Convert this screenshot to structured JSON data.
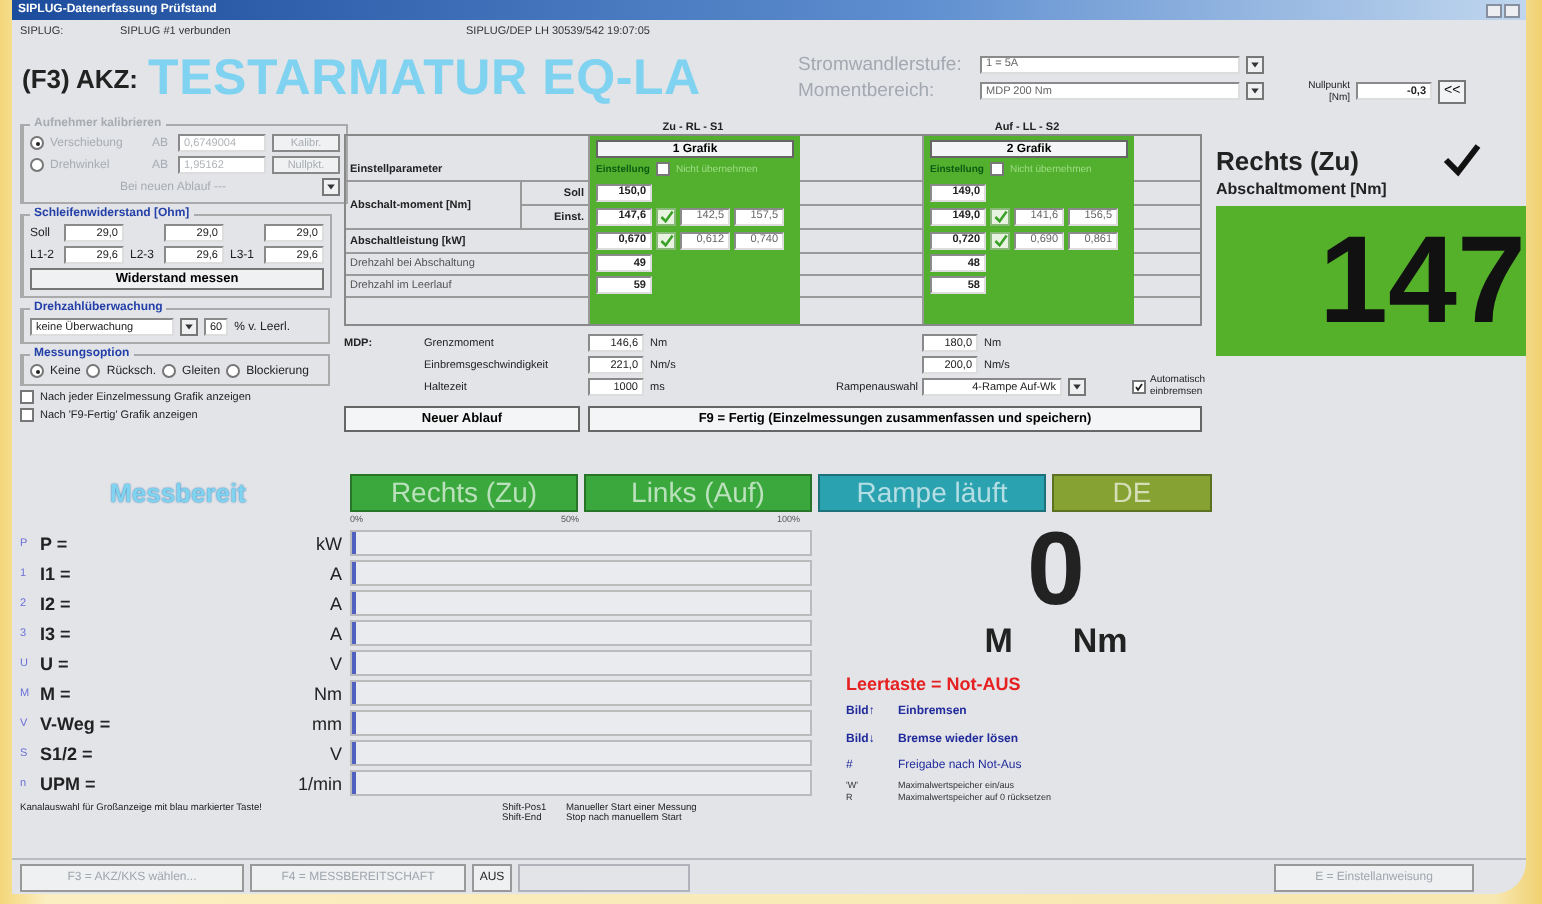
{
  "window": {
    "title": "SIPLUG-Datenerfassung Prüfstand"
  },
  "info_bar": {
    "device_label": "SIPLUG:",
    "connection": "SIPLUG #1 verbunden",
    "station": "SIPLUG/DEP LH 30539/542 19:07:05"
  },
  "header": {
    "akz_label": "(F3) AKZ:",
    "akz": "TESTARMATUR EQ-LA",
    "current_stage": {
      "label": "Stromwandlerstufe:",
      "value": "1 = 5A"
    },
    "torque_range": {
      "label": "Momentbereich:",
      "value": "MDP  200 Nm"
    },
    "zero_point": {
      "label": "Nullpunkt [Nm]",
      "value": "-0,3",
      "button": "<<"
    }
  },
  "calibration": {
    "title": "Aufnehmer kalibrieren",
    "disabled": true,
    "options": [
      {
        "label": "Verschiebung",
        "selected": true,
        "field_label": "AB",
        "value": "0,6749004",
        "button": "Kalibr."
      },
      {
        "label": "Drehwinkel",
        "selected": false,
        "field_label": "AB",
        "value": "1,95162",
        "button": "Nullpkt."
      }
    ],
    "note": "Bei neuen Ablauf ---"
  },
  "resistance": {
    "title": "Schleifenwiderstand [Ohm]",
    "set_label": "Soll",
    "set_values": [
      "29,0",
      "29,0",
      "29,0"
    ],
    "measured": [
      {
        "label": "L1-2",
        "value": "29,6"
      },
      {
        "label": "L2-3",
        "value": "29,6"
      },
      {
        "label": "L3-1",
        "value": "29,6"
      }
    ],
    "button": "Widerstand messen"
  },
  "speed_monitoring": {
    "title": "Drehzahlüberwachung",
    "mode": "keine Überwachung",
    "value": "60",
    "unit": "% v. Leerl."
  },
  "measurement_option": {
    "title": "Messungsoption",
    "options": [
      {
        "label": "Keine",
        "selected": true
      },
      {
        "label": "Rücksch.",
        "selected": false
      },
      {
        "label": "Gleiten",
        "selected": false
      },
      {
        "label": "Blockierung",
        "selected": false
      }
    ]
  },
  "graph_options": [
    {
      "label": "Nach jeder Einzelmessung Grafik anzeigen",
      "checked": false
    },
    {
      "label": "Nach 'F9-Fertig' Grafik anzeigen",
      "checked": false
    }
  ],
  "parameters": {
    "rows_label": "Einstellparameter",
    "torque_label": "Abschalt-moment [Nm]",
    "set_label": "Soll",
    "actual_label": "Einst.",
    "power_label": "Abschaltleistung [kW]",
    "speed_cutoff_label": "Drehzahl bei Abschaltung",
    "speed_idle_label": "Drehzahl im Leerlauf",
    "columns": [
      {
        "heading": "Zu - RL - S1",
        "button": "1 Grafik",
        "setting_label": "Einstellung",
        "skip_label": "Nicht übernehmen",
        "skip": false,
        "torque_set": "150,0",
        "torque_actual": "147,6",
        "torque_ok": true,
        "torque_min": "142,5",
        "torque_max": "157,5",
        "power": "0,670",
        "power_ok": true,
        "power_min": "0,612",
        "power_max": "0,740",
        "speed_cutoff": "49",
        "speed_idle": "59"
      },
      {
        "heading": "Auf - LL - S2",
        "button": "2 Grafik",
        "setting_label": "Einstellung",
        "skip_label": "Nicht übernehmen",
        "skip": false,
        "torque_set": "149,0",
        "torque_actual": "149,0",
        "torque_ok": true,
        "torque_min": "141,6",
        "torque_max": "156,5",
        "power": "0,720",
        "power_ok": true,
        "power_min": "0,690",
        "power_max": "0,861",
        "speed_cutoff": "48",
        "speed_idle": "58"
      }
    ]
  },
  "mdp": {
    "label": "MDP:",
    "rows": [
      {
        "label": "Grenzmoment",
        "value_1": "146,6",
        "unit_1": "Nm",
        "value_2": "180,0",
        "unit_2": "Nm"
      },
      {
        "label": "Einbremsgeschwindigkeit",
        "value_1": "221,0",
        "unit_1": "Nm/s",
        "value_2": "200,0",
        "unit_2": "Nm/s"
      },
      {
        "label": "Haltezeit",
        "value_1": "1000",
        "unit_1": "ms"
      }
    ],
    "ramp": {
      "label": "Rampenauswahl",
      "value": "4-Rampe Auf-Wk"
    },
    "auto_brake": {
      "label": "Automatisch einbremsen",
      "checked": true
    }
  },
  "actions": [
    "Neuer Ablauf",
    "F9 = Fertig (Einzelmessungen zusammenfassen und speichern)"
  ],
  "result": {
    "direction": "Rechts (Zu)",
    "ok": true,
    "label": "Abschaltmoment [Nm]",
    "value": "147"
  },
  "status": {
    "title": "Messbereit",
    "tiles": [
      {
        "label": "Rechts (Zu)",
        "color": "#3aa83c"
      },
      {
        "label": "Links (Auf)",
        "color": "#3aa83c"
      },
      {
        "label": "Rampe läuft",
        "color": "#2aa2b0"
      },
      {
        "label": "DE",
        "color": "#86a232"
      }
    ]
  },
  "channels": {
    "scale": [
      "0%",
      "50%",
      "100%"
    ],
    "rows": [
      {
        "key": "P",
        "label": "P =",
        "unit": "kW",
        "level": 0
      },
      {
        "key": "1",
        "label": "I1 =",
        "unit": "A",
        "level": 0
      },
      {
        "key": "2",
        "label": "I2 =",
        "unit": "A",
        "level": 0
      },
      {
        "key": "3",
        "label": "I3 =",
        "unit": "A",
        "level": 0
      },
      {
        "key": "U",
        "label": "U =",
        "unit": "V",
        "level": 0
      },
      {
        "key": "M",
        "label": "M =",
        "unit": "Nm",
        "level": 0
      },
      {
        "key": "V",
        "label": "V-Weg =",
        "unit": "mm",
        "level": 0
      },
      {
        "key": "S",
        "label": "S1/2 =",
        "unit": "V",
        "level": 0
      },
      {
        "key": "n",
        "label": "UPM =",
        "unit": "1/min",
        "level": 0
      }
    ],
    "note": "Kanalauswahl für Großanzeige mit blau markierter Taste!"
  },
  "manual": [
    {
      "key": "Shift-Pos1",
      "text": "Manueller Start einer Messung"
    },
    {
      "key": "Shift-End",
      "text": "Stop nach manuellem Start"
    }
  ],
  "big_display": {
    "value": "0",
    "symbol": "M",
    "unit": "Nm"
  },
  "shortcuts": [
    {
      "kind": "alarm",
      "text": "Leertaste = Not-AUS"
    },
    {
      "kind": "strong",
      "key": "Bild↑",
      "text": "Einbremsen"
    },
    {
      "kind": "strong",
      "key": "Bild↓",
      "text": "Bremse wieder lösen"
    },
    {
      "kind": "plain",
      "key": "#",
      "text": "Freigabe nach Not-Aus"
    },
    {
      "kind": "note",
      "key": "'W'",
      "text": "Maximalwertspeicher ein/aus"
    },
    {
      "kind": "note",
      "key": "R",
      "text": "Maximalwertspeicher auf 0 rücksetzen"
    }
  ],
  "footer": [
    {
      "label": "F3 = AKZ/KKS wählen...",
      "disabled": true
    },
    {
      "label": "F4 = MESSBEREITSCHAFT",
      "disabled": true
    },
    {
      "label": "AUS",
      "disabled": false
    },
    {
      "label": "E = Einstellanweisung",
      "disabled": true
    }
  ]
}
